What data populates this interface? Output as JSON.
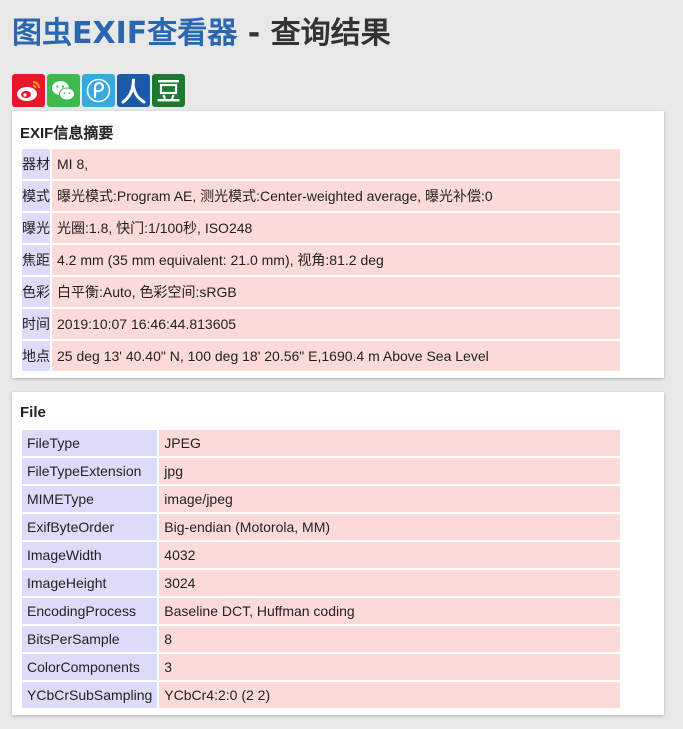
{
  "header": {
    "title_link": "图虫EXIF查看器",
    "title_rest": " - 查询结果"
  },
  "share": [
    {
      "icon": "weibo-icon",
      "color": "#e6162d"
    },
    {
      "icon": "wechat-icon",
      "color": "#3eb94e"
    },
    {
      "icon": "qzone-icon",
      "color": "#38a8e0"
    },
    {
      "icon": "renren-icon",
      "color": "#1a5aa8"
    },
    {
      "icon": "douban-icon",
      "color": "#1b7a2f"
    }
  ],
  "summary": {
    "title": "EXIF信息摘要",
    "rows": [
      {
        "key": "器材",
        "value": "MI 8,"
      },
      {
        "key": "模式",
        "value": "曝光模式:Program AE, 测光模式:Center-weighted average, 曝光补偿:0"
      },
      {
        "key": "曝光",
        "value": "光圈:1.8, 快门:1/100秒, ISO248"
      },
      {
        "key": "焦距",
        "value": "4.2 mm (35 mm equivalent: 21.0 mm), 视角:81.2 deg"
      },
      {
        "key": "色彩",
        "value": "白平衡:Auto, 色彩空间:sRGB"
      },
      {
        "key": "时间",
        "value": "2019:10:07 16:46:44.813605"
      },
      {
        "key": "地点",
        "value": "25 deg 13' 40.40\" N, 100 deg 18' 20.56\" E,1690.4 m Above Sea Level"
      }
    ]
  },
  "file": {
    "title": "File",
    "rows": [
      {
        "key": "FileType",
        "value": "JPEG"
      },
      {
        "key": "FileTypeExtension",
        "value": "jpg"
      },
      {
        "key": "MIMEType",
        "value": "image/jpeg"
      },
      {
        "key": "ExifByteOrder",
        "value": "Big-endian (Motorola, MM)"
      },
      {
        "key": "ImageWidth",
        "value": "4032"
      },
      {
        "key": "ImageHeight",
        "value": "3024"
      },
      {
        "key": "EncodingProcess",
        "value": "Baseline DCT, Huffman coding"
      },
      {
        "key": "BitsPerSample",
        "value": "8"
      },
      {
        "key": "ColorComponents",
        "value": "3"
      },
      {
        "key": "YCbCrSubSampling",
        "value": "YCbCr4:2:0 (2 2)"
      }
    ]
  }
}
